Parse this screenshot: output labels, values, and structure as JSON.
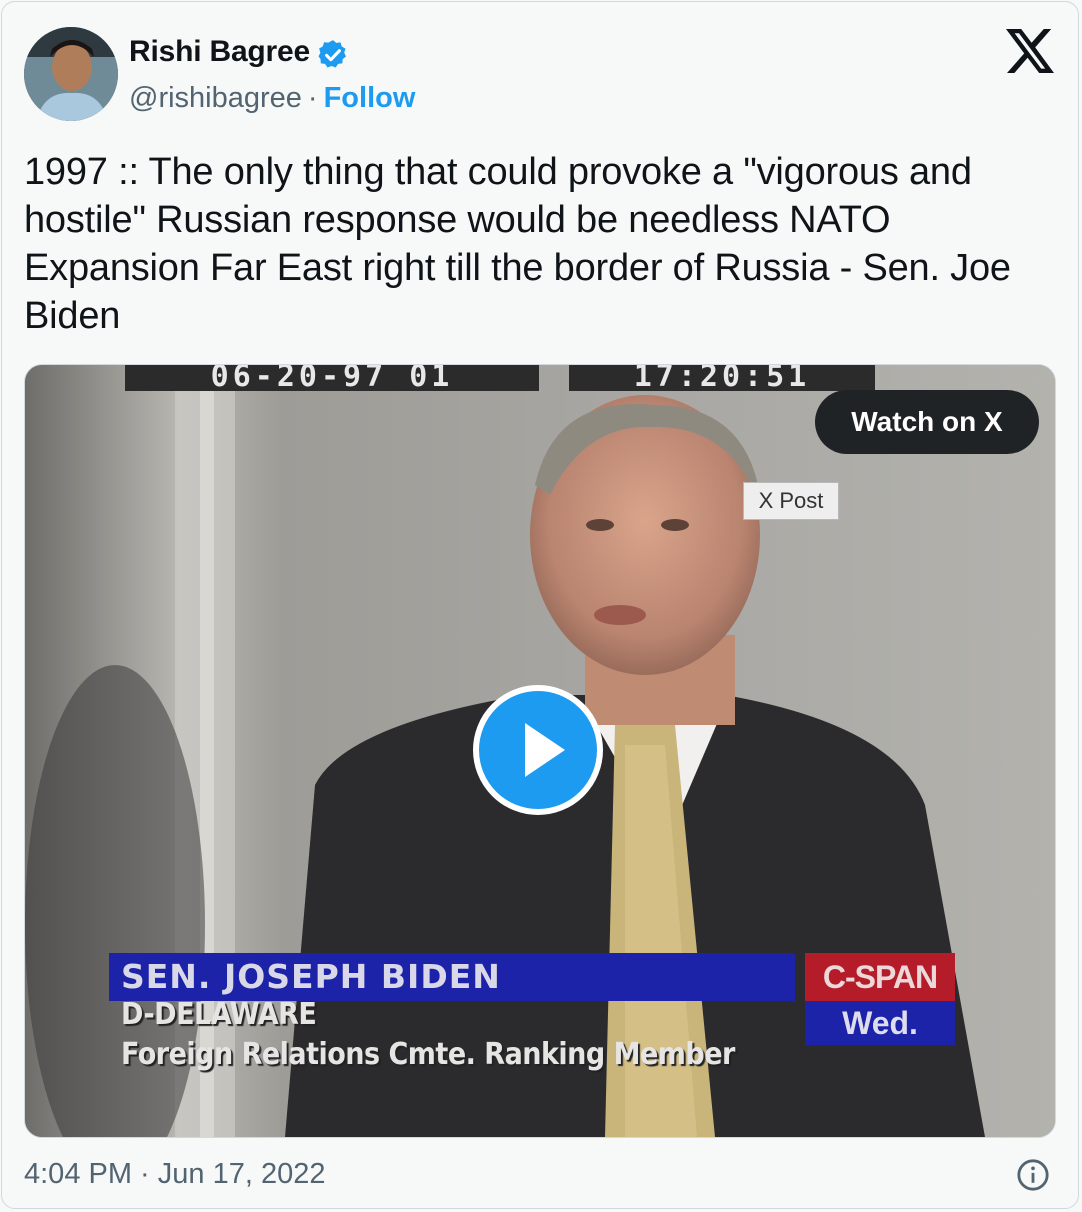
{
  "author": {
    "name": "Rishi Bagree",
    "handle": "@rishibagree",
    "separator": "·",
    "follow_label": "Follow",
    "verified": true
  },
  "tweet": {
    "text": "1997 :: The only thing that could provoke a \"vigorous and hostile\" Russian response would be needless NATO Expansion Far East right till the border of Russia - Sen. Joe Biden"
  },
  "media": {
    "timecode_date": "06-20-97 01",
    "timecode_time": "17:20:51",
    "watch_label": "Watch on X",
    "tooltip": "X Post",
    "lower_third_name": "SEN.  JOSEPH  BIDEN",
    "lower_third_state": "D-DELAWARE",
    "lower_third_role": "Foreign Relations Cmte. Ranking Member",
    "network": "C-SPAN",
    "day": "Wed."
  },
  "footer": {
    "timestamp": "4:04 PM · Jun 17, 2022"
  },
  "icons": {
    "brand": "x-logo-icon",
    "verified": "verified-badge-icon",
    "play": "play-icon",
    "info": "info-icon"
  },
  "colors": {
    "accent": "#1d9bf0",
    "text": "#0f1419",
    "muted": "#536471",
    "background": "#f7f9f9"
  }
}
